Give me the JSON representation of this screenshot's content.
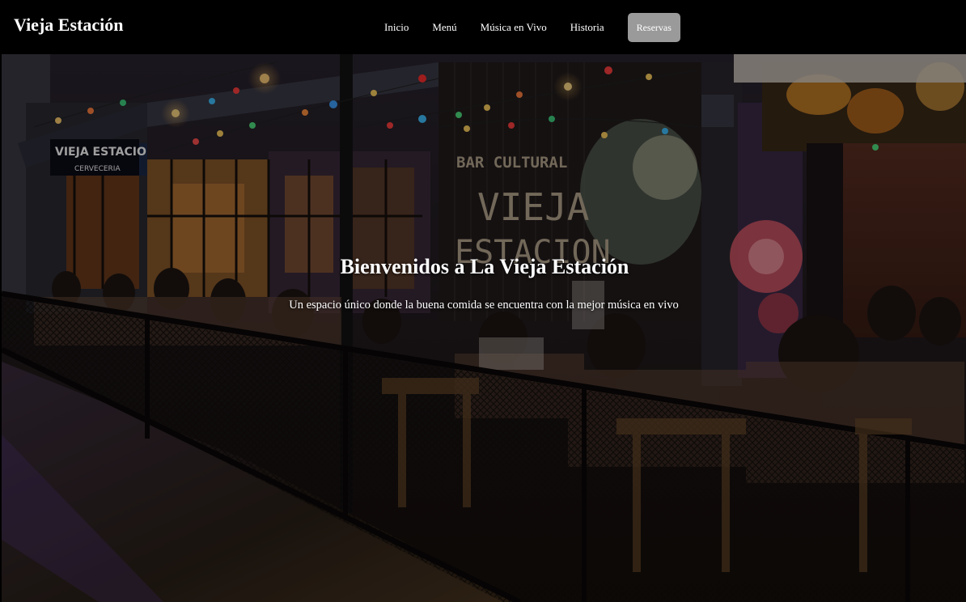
{
  "brand": {
    "name": "Vieja Estación"
  },
  "nav": {
    "links": [
      "Inicio",
      "Menú",
      "Música en Vivo",
      "Historia"
    ],
    "cta": "Reservas"
  },
  "hero": {
    "title": "Bienvenidos a La Vieja Estación",
    "subtitle": "Un espacio único donde la buena comida se encuentra con la mejor música en vivo",
    "sign_text": [
      "BAR CULTURAL",
      "VIEJA",
      "ESTACION"
    ],
    "sign_small": [
      "VIEJA ESTACIO",
      "CERVECERIA"
    ]
  },
  "colors": {
    "nav_bg": "#000000",
    "cta_bg": "#9a9a9a",
    "text": "#ffffff"
  }
}
